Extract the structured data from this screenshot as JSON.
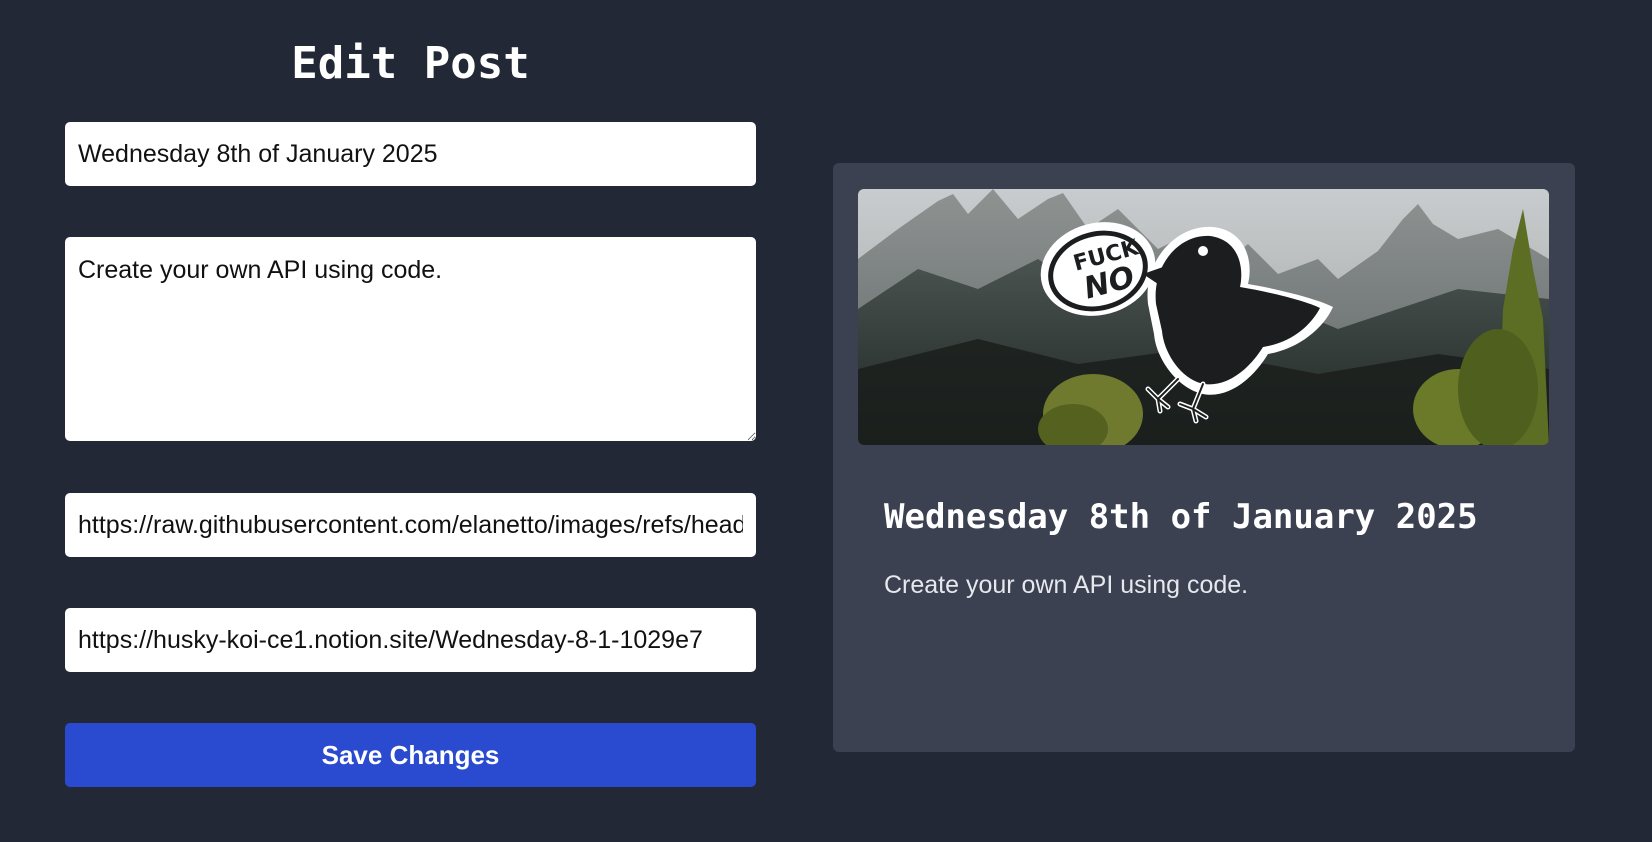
{
  "page": {
    "title": "Edit Post"
  },
  "form": {
    "title_value": "Wednesday 8th of January 2025",
    "content_value": "Create your own API using code.",
    "image_url_value": "https://raw.githubusercontent.com/elanetto/images/refs/heads/main/fuck-no-bird.png",
    "link_url_value": "https://husky-koi-ce1.notion.site/Wednesday-8-1-1029e7",
    "save_label": "Save Changes"
  },
  "preview": {
    "title": "Wednesday 8th of January 2025",
    "description": "Create your own API using code.",
    "sticker_text_line1": "FUCK",
    "sticker_text_line2": "NO"
  },
  "colors": {
    "background": "#222836",
    "card": "#3b4151",
    "accent_button": "#2a4bd0"
  }
}
